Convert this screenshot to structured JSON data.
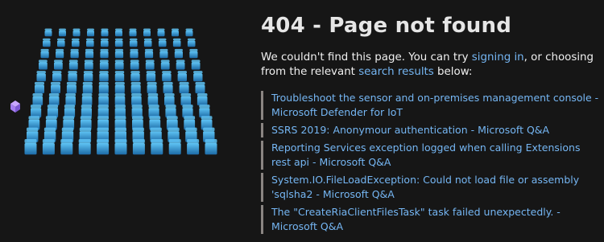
{
  "heading": "404 - Page not found",
  "intro": {
    "text_before": "We couldn't find this page. You can try ",
    "signin_link": "signing in",
    "text_middle": ", or choosing from the relevant ",
    "search_link": "search results",
    "text_after": " below:"
  },
  "results": [
    {
      "title": "Troubleshoot the sensor and on-premises management console - Microsoft Defender for IoT"
    },
    {
      "title": "SSRS 2019: Anonymour authentication - Microsoft Q&A"
    },
    {
      "title": "Reporting Services exception logged when calling Extensions rest api - Microsoft Q&A"
    },
    {
      "title": "System.IO.FileLoadException: Could not load file or assembly 'sqlsha2 - Microsoft Q&A"
    },
    {
      "title": "The \"CreateRiaClientFilesTask\" task failed unexpectedly. - Microsoft Q&A"
    }
  ],
  "colors": {
    "background": "#161616",
    "link": "#75b6f3",
    "result_border": "#8a8582",
    "cube_light": "#5fc3f4",
    "cube_dark": "#1c6aa6",
    "stray_cube": "#a57ef0"
  },
  "illustration": {
    "icon": "cube-grid-illustration",
    "stray_icon": "purple-cube-icon"
  }
}
